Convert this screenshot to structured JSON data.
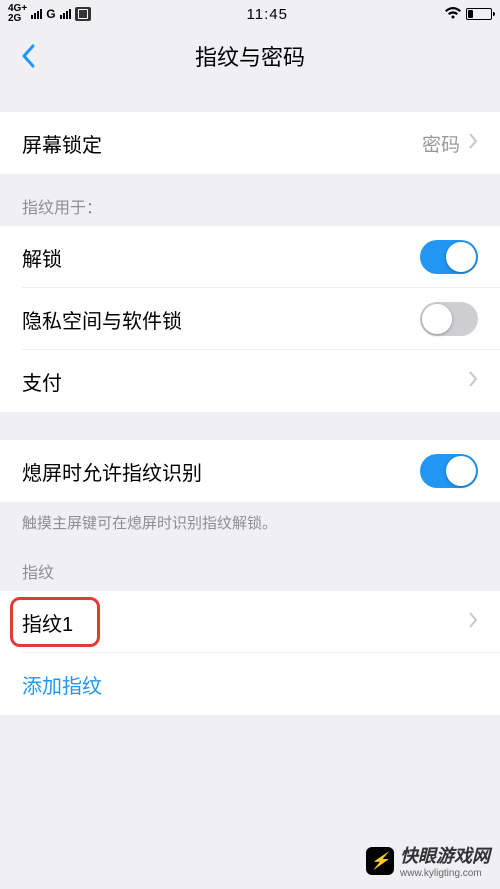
{
  "status": {
    "net1": "4G+",
    "net2": "2G",
    "net3": "G",
    "time": "11:45"
  },
  "header": {
    "title": "指纹与密码"
  },
  "screenLock": {
    "label": "屏幕锁定",
    "value": "密码"
  },
  "section1": {
    "hint": "指纹用于：",
    "unlock": {
      "label": "解锁",
      "on": true
    },
    "privacy": {
      "label": "隐私空间与软件锁",
      "on": false
    },
    "pay": {
      "label": "支付"
    }
  },
  "section2": {
    "allowOff": {
      "label": "熄屏时允许指纹识别",
      "on": true
    },
    "note": "触摸主屏键可在熄屏时识别指纹解锁。"
  },
  "section3": {
    "hint": "指纹",
    "fp1": {
      "label": "指纹1"
    },
    "add": {
      "label": "添加指纹"
    }
  },
  "watermark": {
    "name": "快眼游戏网",
    "url": "www.kyligting.com"
  }
}
